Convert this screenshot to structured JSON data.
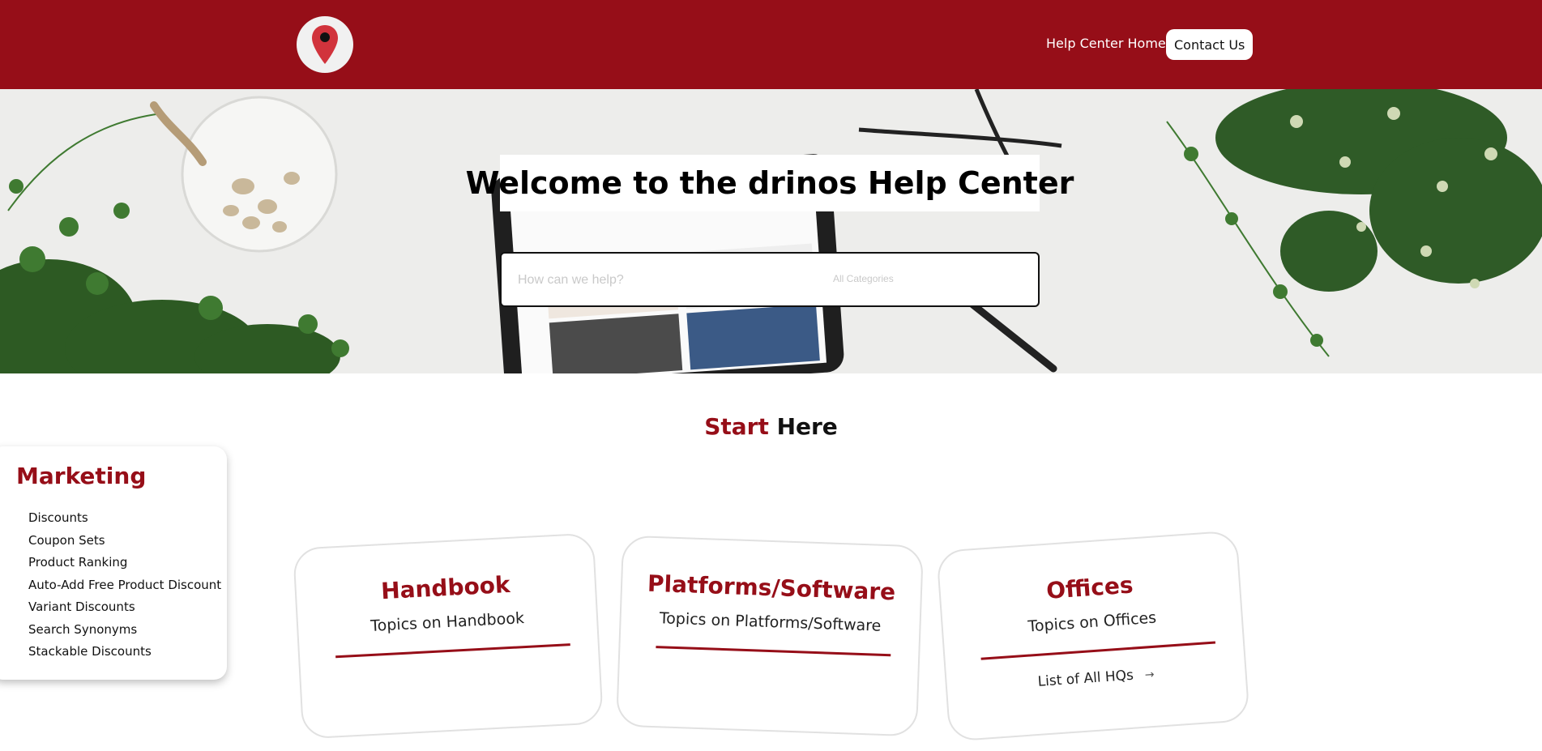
{
  "header": {
    "logo_icon": "map-pin-icon",
    "nav": {
      "home_label": "Help Center Home",
      "contact_label": "Contact Us"
    },
    "brand_color": "#960e18"
  },
  "hero": {
    "title": "Welcome to the drinos Help Center",
    "search": {
      "placeholder": "How can we help?",
      "category_label": "All Categories"
    }
  },
  "start_section": {
    "title_accent": "Start",
    "title_rest": "Here"
  },
  "marketing": {
    "title": "Marketing",
    "items": [
      "Discounts",
      "Coupon Sets",
      "Product Ranking",
      "Auto-Add Free Product Discount",
      "Variant Discounts",
      "Search Synonyms",
      "Stackable Discounts"
    ]
  },
  "cards": [
    {
      "title": "Handbook",
      "subtitle": "Topics on Handbook"
    },
    {
      "title": "Platforms/Software",
      "subtitle": "Topics on Platforms/Software"
    },
    {
      "title": "Offices",
      "subtitle": "Topics on Offices",
      "link": "List of All HQs",
      "link_icon": "arrow-right-icon"
    }
  ]
}
